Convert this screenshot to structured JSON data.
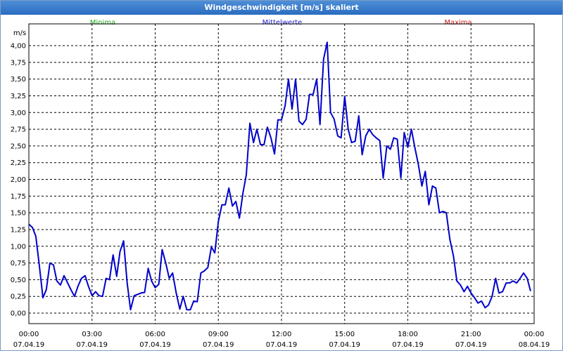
{
  "window": {
    "title": "Windgeschwindigkeit [m/s] skaliert"
  },
  "chart_data": {
    "type": "line",
    "title": "Windgeschwindigkeit [m/s] skaliert",
    "ylabel": "m/s",
    "ylim": [
      0,
      4.0
    ],
    "yticks": [
      "0,00",
      "0,25",
      "0,50",
      "0,75",
      "1,00",
      "1,25",
      "1,50",
      "1,75",
      "2,00",
      "2,25",
      "2,50",
      "2,75",
      "3,00",
      "3,25",
      "3,50",
      "3,75",
      "4,00"
    ],
    "xlim_hours": [
      0,
      24
    ],
    "xticks": [
      {
        "time": "00:00",
        "date": "07.04.19"
      },
      {
        "time": "03:00",
        "date": "07.04.19"
      },
      {
        "time": "06:00",
        "date": "07.04.19"
      },
      {
        "time": "09:00",
        "date": "07.04.19"
      },
      {
        "time": "12:00",
        "date": "07.04.19"
      },
      {
        "time": "15:00",
        "date": "07.04.19"
      },
      {
        "time": "18:00",
        "date": "07.04.19"
      },
      {
        "time": "21:00",
        "date": "07.04.19"
      },
      {
        "time": "00:00",
        "date": "08.04.19"
      }
    ],
    "legend": [
      {
        "label": "Minima",
        "color": "#22aa22"
      },
      {
        "label": "Mittelwerte",
        "color": "#2222cc"
      },
      {
        "label": "Maxima",
        "color": "#cc2222"
      }
    ],
    "series": [
      {
        "name": "Mittelwerte",
        "color": "#0000cc",
        "points": [
          [
            0.0,
            1.33
          ],
          [
            0.17,
            1.28
          ],
          [
            0.33,
            1.15
          ],
          [
            0.5,
            0.7
          ],
          [
            0.67,
            0.23
          ],
          [
            0.83,
            0.35
          ],
          [
            1.0,
            0.75
          ],
          [
            1.17,
            0.72
          ],
          [
            1.33,
            0.48
          ],
          [
            1.5,
            0.42
          ],
          [
            1.67,
            0.56
          ],
          [
            1.83,
            0.46
          ],
          [
            2.0,
            0.35
          ],
          [
            2.17,
            0.25
          ],
          [
            2.33,
            0.4
          ],
          [
            2.5,
            0.52
          ],
          [
            2.67,
            0.56
          ],
          [
            2.83,
            0.4
          ],
          [
            3.0,
            0.26
          ],
          [
            3.17,
            0.32
          ],
          [
            3.33,
            0.26
          ],
          [
            3.5,
            0.25
          ],
          [
            3.67,
            0.52
          ],
          [
            3.83,
            0.5
          ],
          [
            4.0,
            0.87
          ],
          [
            4.17,
            0.55
          ],
          [
            4.33,
            0.92
          ],
          [
            4.5,
            1.08
          ],
          [
            4.67,
            0.45
          ],
          [
            4.83,
            0.05
          ],
          [
            5.0,
            0.26
          ],
          [
            5.17,
            0.28
          ],
          [
            5.33,
            0.3
          ],
          [
            5.5,
            0.31
          ],
          [
            5.67,
            0.67
          ],
          [
            5.83,
            0.48
          ],
          [
            6.0,
            0.38
          ],
          [
            6.17,
            0.43
          ],
          [
            6.33,
            0.95
          ],
          [
            6.5,
            0.75
          ],
          [
            6.67,
            0.52
          ],
          [
            6.83,
            0.6
          ],
          [
            7.0,
            0.3
          ],
          [
            7.17,
            0.06
          ],
          [
            7.33,
            0.25
          ],
          [
            7.5,
            0.05
          ],
          [
            7.67,
            0.05
          ],
          [
            7.83,
            0.18
          ],
          [
            8.0,
            0.17
          ],
          [
            8.17,
            0.6
          ],
          [
            8.33,
            0.63
          ],
          [
            8.5,
            0.68
          ],
          [
            8.67,
            0.99
          ],
          [
            8.83,
            0.9
          ],
          [
            9.0,
            1.37
          ],
          [
            9.17,
            1.62
          ],
          [
            9.33,
            1.62
          ],
          [
            9.5,
            1.87
          ],
          [
            9.67,
            1.6
          ],
          [
            9.83,
            1.67
          ],
          [
            10.0,
            1.42
          ],
          [
            10.17,
            1.8
          ],
          [
            10.33,
            2.07
          ],
          [
            10.5,
            2.84
          ],
          [
            10.67,
            2.55
          ],
          [
            10.83,
            2.75
          ],
          [
            11.0,
            2.52
          ],
          [
            11.17,
            2.52
          ],
          [
            11.33,
            2.78
          ],
          [
            11.5,
            2.62
          ],
          [
            11.67,
            2.38
          ],
          [
            11.83,
            2.89
          ],
          [
            12.0,
            2.89
          ],
          [
            12.17,
            3.1
          ],
          [
            12.33,
            3.5
          ],
          [
            12.5,
            3.05
          ],
          [
            12.67,
            3.5
          ],
          [
            12.83,
            2.87
          ],
          [
            13.0,
            2.82
          ],
          [
            13.17,
            2.9
          ],
          [
            13.33,
            3.27
          ],
          [
            13.5,
            3.27
          ],
          [
            13.67,
            3.5
          ],
          [
            13.83,
            2.82
          ],
          [
            14.0,
            3.8
          ],
          [
            14.17,
            4.05
          ],
          [
            14.33,
            3.0
          ],
          [
            14.5,
            2.9
          ],
          [
            14.67,
            2.65
          ],
          [
            14.83,
            2.62
          ],
          [
            15.0,
            3.24
          ],
          [
            15.17,
            2.75
          ],
          [
            15.33,
            2.55
          ],
          [
            15.5,
            2.57
          ],
          [
            15.67,
            2.95
          ],
          [
            15.83,
            2.37
          ],
          [
            16.0,
            2.65
          ],
          [
            16.17,
            2.75
          ],
          [
            16.33,
            2.67
          ],
          [
            16.5,
            2.62
          ],
          [
            16.67,
            2.58
          ],
          [
            16.83,
            2.02
          ],
          [
            17.0,
            2.5
          ],
          [
            17.17,
            2.45
          ],
          [
            17.33,
            2.62
          ],
          [
            17.5,
            2.6
          ],
          [
            17.67,
            2.02
          ],
          [
            17.83,
            2.7
          ],
          [
            18.0,
            2.48
          ],
          [
            18.17,
            2.75
          ],
          [
            18.33,
            2.48
          ],
          [
            18.5,
            2.22
          ],
          [
            18.67,
            1.9
          ],
          [
            18.83,
            2.12
          ],
          [
            19.0,
            1.62
          ],
          [
            19.17,
            1.9
          ],
          [
            19.33,
            1.87
          ],
          [
            19.5,
            1.5
          ],
          [
            19.67,
            1.52
          ],
          [
            19.83,
            1.5
          ],
          [
            20.0,
            1.1
          ],
          [
            20.17,
            0.85
          ],
          [
            20.33,
            0.48
          ],
          [
            20.5,
            0.42
          ],
          [
            20.67,
            0.32
          ],
          [
            20.83,
            0.4
          ],
          [
            21.0,
            0.3
          ],
          [
            21.17,
            0.23
          ],
          [
            21.33,
            0.15
          ],
          [
            21.5,
            0.18
          ],
          [
            21.67,
            0.08
          ],
          [
            21.83,
            0.12
          ],
          [
            22.0,
            0.25
          ],
          [
            22.17,
            0.52
          ],
          [
            22.33,
            0.3
          ],
          [
            22.5,
            0.32
          ],
          [
            22.67,
            0.45
          ],
          [
            22.83,
            0.45
          ],
          [
            23.0,
            0.48
          ],
          [
            23.17,
            0.45
          ],
          [
            23.33,
            0.52
          ],
          [
            23.5,
            0.6
          ],
          [
            23.67,
            0.52
          ],
          [
            23.83,
            0.33
          ]
        ]
      }
    ]
  }
}
